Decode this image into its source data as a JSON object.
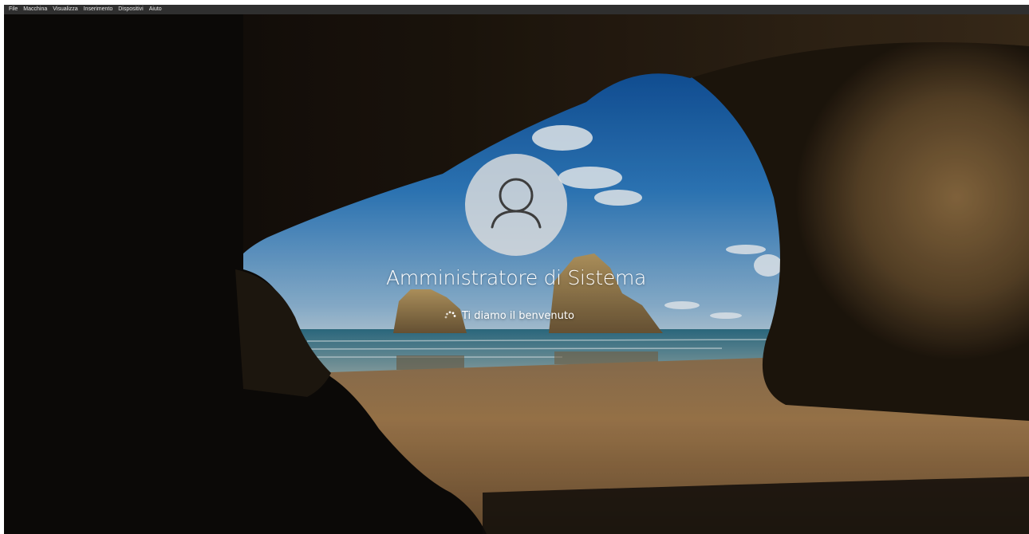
{
  "menubar": {
    "items": [
      {
        "label": "File"
      },
      {
        "label": "Macchina"
      },
      {
        "label": "Visualizza"
      },
      {
        "label": "Inserimento"
      },
      {
        "label": "Dispositivi"
      },
      {
        "label": "Aiuto"
      }
    ]
  },
  "login": {
    "user_name": "Amministratore di Sistema",
    "status": "Ti diamo il benvenuto",
    "avatar_icon": "user-icon",
    "spinner_icon": "loading-spinner-icon"
  },
  "colors": {
    "menubar_bg": "#2f2f2f",
    "menubar_text": "#e6e6e6",
    "login_text": "#ffffff",
    "avatar_bg": "#dedede"
  }
}
